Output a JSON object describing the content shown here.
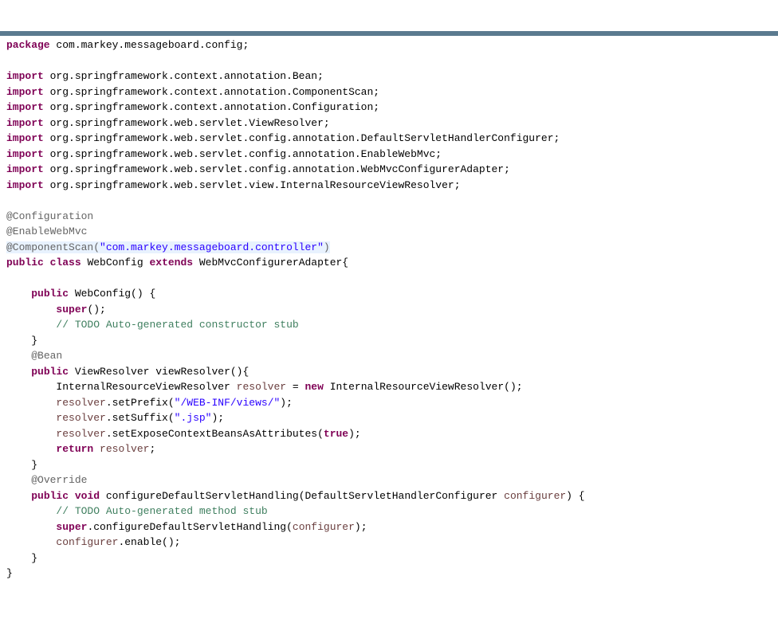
{
  "code": {
    "package_kw": "package",
    "package_name": " com.markey.messageboard.config;",
    "import_kw": "import",
    "imports": [
      " org.springframework.context.annotation.Bean;",
      " org.springframework.context.annotation.ComponentScan;",
      " org.springframework.context.annotation.Configuration;",
      " org.springframework.web.servlet.ViewResolver;",
      " org.springframework.web.servlet.config.annotation.DefaultServletHandlerConfigurer;",
      " org.springframework.web.servlet.config.annotation.EnableWebMvc;",
      " org.springframework.web.servlet.config.annotation.WebMvcConfigurerAdapter;",
      " org.springframework.web.servlet.view.InternalResourceViewResolver;"
    ],
    "ann_configuration": "@Configuration",
    "ann_enablewebmvc": "@EnableWebMvc",
    "ann_componentscan_open": "@ComponentScan(",
    "ann_componentscan_str": "\"com.markey.messageboard.controller\"",
    "ann_componentscan_close": ")",
    "public_kw": "public",
    "class_kw": "class",
    "class_name": " WebConfig ",
    "extends_kw": "extends",
    "extends_name": " WebMvcConfigurerAdapter{",
    "ctor_sig": " WebConfig() {",
    "super_kw": "super",
    "super_call": "();",
    "ctor_comment": "// TODO Auto-generated constructor stub",
    "brace_close": "}",
    "ann_bean": "@Bean",
    "viewresolver_ret": " ViewResolver viewResolver(){",
    "resolver_decl_1": "InternalResourceViewResolver ",
    "resolver_var": "resolver",
    "resolver_decl_2": " = ",
    "new_kw": "new",
    "resolver_decl_3": " InternalResourceViewResolver();",
    "setprefix_1": ".setPrefix(",
    "setprefix_str": "\"/WEB-INF/views/\"",
    "setprefix_2": ");",
    "setsuffix_1": ".setSuffix(",
    "setsuffix_str": "\".jsp\"",
    "setsuffix_2": ");",
    "setexpose_1": ".setExposeContextBeansAsAttributes(",
    "true_kw": "true",
    "setexpose_2": ");",
    "return_kw": "return",
    "return_stmt": ";",
    "ann_override": "@Override",
    "void_kw": "void",
    "method_sig_1": " configureDefaultServletHandling(DefaultServletHandlerConfigurer ",
    "configurer_var": "configurer",
    "method_sig_2": ") {",
    "method_comment": "// TODO Auto-generated method stub",
    "super_call2_1": ".configureDefaultServletHandling(",
    "super_call2_2": ");",
    "enable_call": ".enable();"
  }
}
